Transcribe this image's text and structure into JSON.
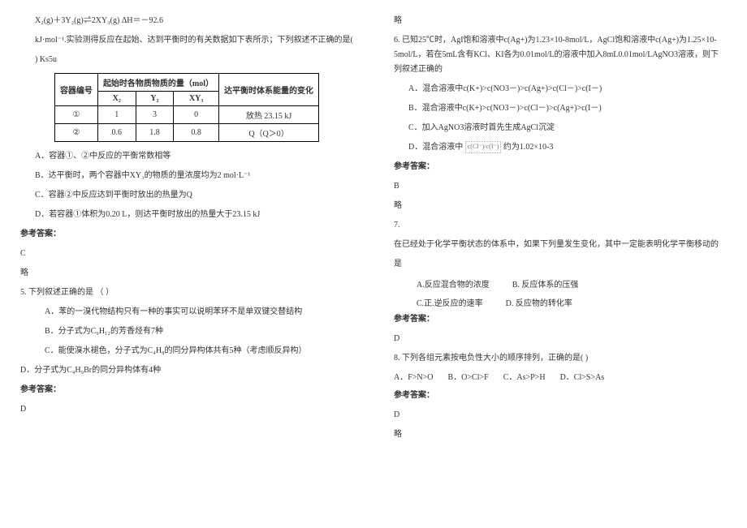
{
  "left": {
    "eq": "X₂(g)＋3Y₂(g)⇌2XY₃(g)    ΔH＝－92.6",
    "q4_stem1": "kJ·mol⁻¹.实验测得反应在起始、达到平衡时的有关数据如下表所示；下列叙述不正确的是(",
    "q4_stem2": ") Ks5u",
    "tbl": {
      "h_container": "容器编号",
      "h_initial": "起始时各物质物质的量（mol）",
      "h_energy": "达平衡时体系能量的变化",
      "c_x2": "X₂",
      "c_y2": "Y₂",
      "c_xy3": "XY₃",
      "r1_no": "①",
      "r1_x2": "1",
      "r1_y2": "3",
      "r1_xy3": "0",
      "r1_e": "放热 23.15 kJ",
      "r2_no": "②",
      "r2_x2": "0.6",
      "r2_y2": "1.8",
      "r2_xy3": "0.8",
      "r2_e": "Q（Q＞0）"
    },
    "q4_A": "A．容器①、②中反应的平衡常数相等",
    "q4_B": "B．达平衡时，两个容器中XY₃的物质的量浓度均为2 mol·L⁻¹",
    "q4_C": "C．容器②中反应达到平衡时放出的热量为Q",
    "q4_D": "D．若容器①体积为0.20 L，则达平衡时放出的热量大于23.15 kJ",
    "ans_label": "参考答案：",
    "q4_ans": "C",
    "lue": "略",
    "q5_stem": "5. 下列叙述正确的是                        （     ）",
    "q5_A": "A．苯的一溴代物结构只有一种的事实可以说明苯环不是单双键交替结构",
    "q5_B": "B．分子式为C₉H₁₂的芳香烃有7种",
    "q5_C": "C．能使溴水褪色，分子式为C₄H₈的同分异构体共有5种（考虑顺反异构）",
    "q5_D": "D．分子式为C₄H₉Br的同分异构体有4种",
    "q5_ans": "D"
  },
  "right": {
    "lue": "略",
    "q6_l1": "6. 已知25℃时，AgI饱和溶液中c(Ag+)为1.23×10-8mol/L，AgCl饱和溶液中c(Ag+)为1.25×10-",
    "q6_l2": "5mol/L，若在5mL含有KCl、KI各为0.01mol/L的溶液中加入8mL0.01mol/LAgNO3溶液，则下",
    "q6_l3": "列叙述正确的",
    "q6_A": "A．混合溶液中c(K+)>c(NO3－)>c(Ag+)>c(Cl－)>c(I－)",
    "q6_B": "B．混合溶液中c(K+)>c(NO3－)>c(Cl－)>c(Ag+)>c(I－)",
    "q6_C": "C．加入AgNO3溶液时首先生成AgCl沉淀",
    "q6_D_pre": "D．混合溶液中",
    "q6_D_frac": "c(Cl⁻)/c(I⁻)",
    "q6_D_post": "约为1.02×10-3",
    "ans_label": "参考答案：",
    "q6_ans": "B",
    "q7_no": "7.",
    "q7_l1": "在已经处于化学平衡状态的体系中，如果下列量发生变化，其中一定能表明化学平衡移动的",
    "q7_l2": "是",
    "q7_A": "A.反应混合物的浓度",
    "q7_B": "B. 反应体系的压强",
    "q7_C": "C.正.逆反应的速率",
    "q7_D": "D. 反应物的转化率",
    "q7_ans": "D",
    "q8_stem": "8. 下列各组元素按电负性大小的顺序排列，正确的是(       )",
    "q8_A": "A．F>N>O",
    "q8_B": "B．O>Cl>F",
    "q8_C": "C．As>P>H",
    "q8_D": "D．Cl>S>As",
    "q8_ans": "D"
  }
}
